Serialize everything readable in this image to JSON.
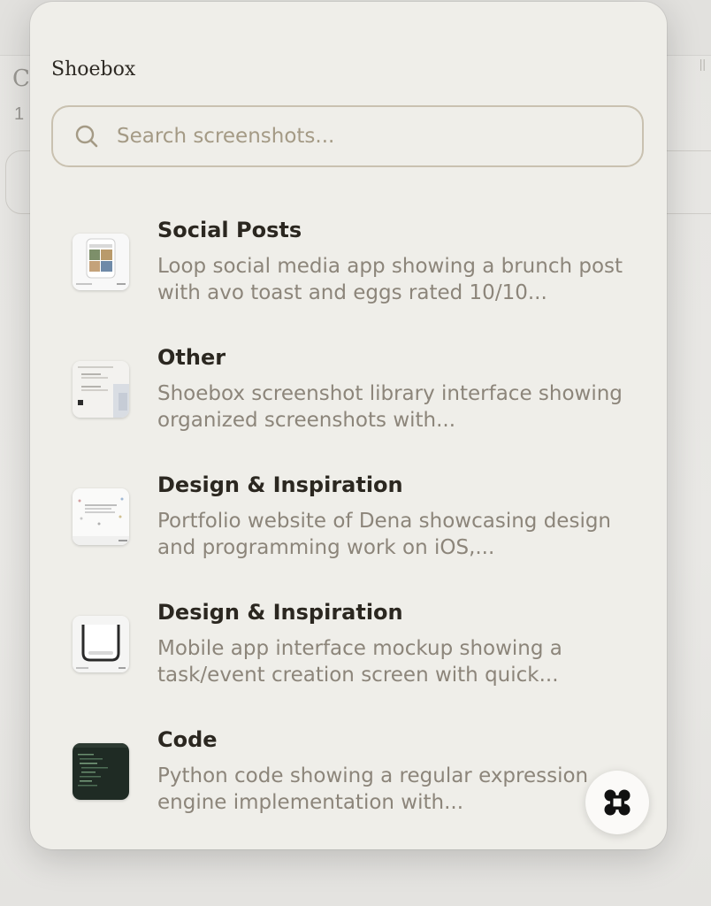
{
  "app": {
    "title": "Shoebox"
  },
  "search": {
    "placeholder": "Search screenshots..."
  },
  "results": [
    {
      "category": "Social Posts",
      "description": "Loop social media app showing a brunch post with avo toast and eggs rated 10/10...",
      "thumbnail": "social-post-thumbnail"
    },
    {
      "category": "Other",
      "description": "Shoebox screenshot library interface showing organized screenshots with...",
      "thumbnail": "shoebox-library-thumbnail"
    },
    {
      "category": "Design & Inspiration",
      "description": "Portfolio website of Dena showcasing design and programming work on iOS,...",
      "thumbnail": "portfolio-thumbnail"
    },
    {
      "category": "Design & Inspiration",
      "description": "Mobile app interface mockup showing a task/event creation screen with quick...",
      "thumbnail": "mobile-mockup-thumbnail"
    },
    {
      "category": "Code",
      "description": "Python code showing a regular expression engine implementation with...",
      "thumbnail": "code-thumbnail"
    }
  ],
  "colors": {
    "panel": "#efeee9",
    "text_primary": "#2b2720",
    "text_secondary": "#8c857a",
    "search_border": "#c9c1b0",
    "placeholder": "#a49a85"
  },
  "icons": {
    "search": "magnifier-icon",
    "fab": "command-key-icon"
  }
}
